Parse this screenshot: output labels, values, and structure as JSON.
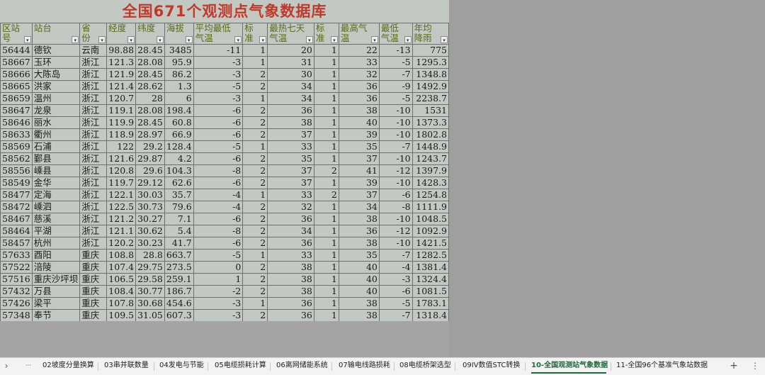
{
  "sheet": {
    "title": "全国671个观测点气象数据库",
    "headers": [
      "区站号",
      "站台",
      "省份",
      "经度",
      "纬度",
      "海拔",
      "平均最低气温",
      "标准",
      "最热七天气温",
      "标准",
      "最高气温",
      "最低气温",
      "年均降雨"
    ],
    "rows": [
      [
        "56444",
        "德钦",
        "云南",
        "98.88",
        "28.45",
        "3485",
        "-11",
        "1",
        "20",
        "1",
        "22",
        "-13",
        "775"
      ],
      [
        "58667",
        "玉环",
        "浙江",
        "121.3",
        "28.08",
        "95.9",
        "-3",
        "1",
        "31",
        "1",
        "33",
        "-5",
        "1295.3"
      ],
      [
        "58666",
        "大陈岛",
        "浙江",
        "121.9",
        "28.45",
        "86.2",
        "-3",
        "2",
        "30",
        "1",
        "32",
        "-7",
        "1348.8"
      ],
      [
        "58665",
        "洪家",
        "浙江",
        "121.4",
        "28.62",
        "1.3",
        "-5",
        "2",
        "34",
        "1",
        "36",
        "-9",
        "1492.9"
      ],
      [
        "58659",
        "温州",
        "浙江",
        "120.7",
        "28",
        "6",
        "-3",
        "1",
        "34",
        "1",
        "36",
        "-5",
        "2238.7"
      ],
      [
        "58647",
        "龙泉",
        "浙江",
        "119.1",
        "28.08",
        "198.4",
        "-6",
        "2",
        "36",
        "1",
        "38",
        "-10",
        "1531"
      ],
      [
        "58646",
        "丽水",
        "浙江",
        "119.9",
        "28.45",
        "60.8",
        "-6",
        "2",
        "38",
        "1",
        "40",
        "-10",
        "1373.3"
      ],
      [
        "58633",
        "衢州",
        "浙江",
        "118.9",
        "28.97",
        "66.9",
        "-6",
        "2",
        "37",
        "1",
        "39",
        "-10",
        "1802.8"
      ],
      [
        "58569",
        "石浦",
        "浙江",
        "122",
        "29.2",
        "128.4",
        "-5",
        "1",
        "33",
        "1",
        "35",
        "-7",
        "1448.9"
      ],
      [
        "58562",
        "鄞县",
        "浙江",
        "121.6",
        "29.87",
        "4.2",
        "-6",
        "2",
        "35",
        "1",
        "37",
        "-10",
        "1243.7"
      ],
      [
        "58556",
        "嵊县",
        "浙江",
        "120.8",
        "29.6",
        "104.3",
        "-8",
        "2",
        "37",
        "2",
        "41",
        "-12",
        "1397.9"
      ],
      [
        "58549",
        "金华",
        "浙江",
        "119.7",
        "29.12",
        "62.6",
        "-6",
        "2",
        "37",
        "1",
        "39",
        "-10",
        "1428.3"
      ],
      [
        "58477",
        "定海",
        "浙江",
        "122.1",
        "30.03",
        "35.7",
        "-4",
        "1",
        "33",
        "2",
        "37",
        "-6",
        "1254.8"
      ],
      [
        "58472",
        "嵊泗",
        "浙江",
        "122.5",
        "30.73",
        "79.6",
        "-4",
        "2",
        "32",
        "1",
        "34",
        "-8",
        "1111.9"
      ],
      [
        "58467",
        "慈溪",
        "浙江",
        "121.2",
        "30.27",
        "7.1",
        "-6",
        "2",
        "36",
        "1",
        "38",
        "-10",
        "1048.5"
      ],
      [
        "58464",
        "平湖",
        "浙江",
        "121.1",
        "30.62",
        "5.4",
        "-8",
        "2",
        "34",
        "1",
        "36",
        "-12",
        "1092.9"
      ],
      [
        "58457",
        "杭州",
        "浙江",
        "120.2",
        "30.23",
        "41.7",
        "-6",
        "2",
        "36",
        "1",
        "38",
        "-10",
        "1421.5"
      ],
      [
        "57633",
        "酉阳",
        "重庆",
        "108.8",
        "28.8",
        "663.7",
        "-5",
        "1",
        "33",
        "1",
        "35",
        "-7",
        "1282.5"
      ],
      [
        "57522",
        "涪陵",
        "重庆",
        "107.4",
        "29.75",
        "273.5",
        "0",
        "2",
        "38",
        "1",
        "40",
        "-4",
        "1381.4"
      ],
      [
        "57516",
        "重庆沙坪坝",
        "重庆",
        "106.5",
        "29.58",
        "259.1",
        "1",
        "2",
        "38",
        "1",
        "40",
        "-3",
        "1324.4"
      ],
      [
        "57432",
        "万县",
        "重庆",
        "108.4",
        "30.77",
        "186.7",
        "-2",
        "2",
        "38",
        "1",
        "40",
        "-6",
        "1081.5"
      ],
      [
        "57426",
        "梁平",
        "重庆",
        "107.8",
        "30.68",
        "454.6",
        "-3",
        "1",
        "36",
        "1",
        "38",
        "-5",
        "1783.1"
      ],
      [
        "57348",
        "奉节",
        "重庆",
        "109.5",
        "31.05",
        "607.3",
        "-3",
        "2",
        "36",
        "1",
        "38",
        "-7",
        "1318.4"
      ]
    ]
  },
  "tabbar": {
    "nav_prev": "›",
    "nav_more": "···",
    "tabs": [
      "02坡度分量换算",
      "03串并联数量",
      "04发电与节能",
      "05电缆损耗计算",
      "06离网储能系统",
      "07输电线路损耗",
      "08电缆桥架选型",
      "09IV数值STC转换",
      "10-全国观测站气象数据",
      "11-全国96个基准气象站数据"
    ],
    "active_index": 8,
    "add": "+",
    "menu": "⋮",
    "accent": "#1e6b3a"
  },
  "colors": {
    "title": "#c0392b",
    "header_text": "#5a6a1a",
    "sheet_bg": "#c2c8c2"
  }
}
